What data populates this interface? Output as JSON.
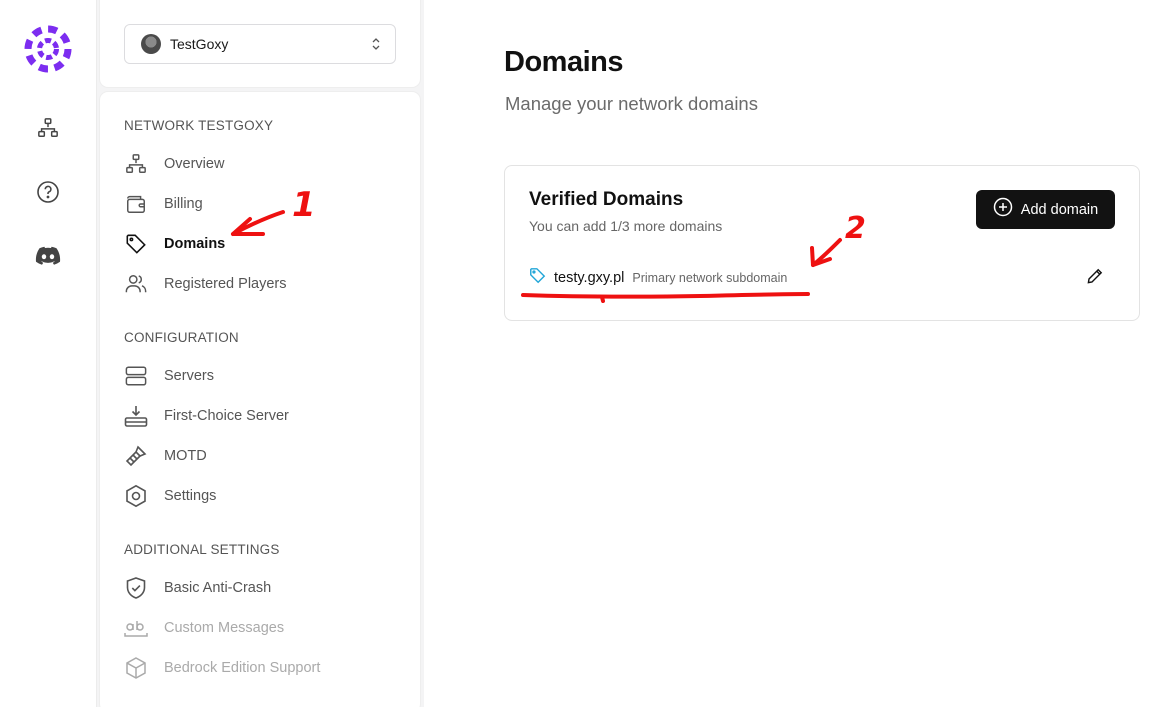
{
  "network_select": {
    "name": "TestGoxy"
  },
  "sidebar": {
    "sections": [
      {
        "title": "NETWORK TESTGOXY"
      },
      {
        "title": "CONFIGURATION"
      },
      {
        "title": "ADDITIONAL SETTINGS"
      }
    ],
    "items": [
      {
        "label": "Overview",
        "icon": "network-icon"
      },
      {
        "label": "Billing",
        "icon": "wallet-icon"
      },
      {
        "label": "Domains",
        "icon": "tag-icon"
      },
      {
        "label": "Registered Players",
        "icon": "users-icon"
      },
      {
        "label": "Servers",
        "icon": "server-icon"
      },
      {
        "label": "First-Choice Server",
        "icon": "download-tray-icon"
      },
      {
        "label": "MOTD",
        "icon": "brush-icon"
      },
      {
        "label": "Settings",
        "icon": "hexagon-gear-icon"
      },
      {
        "label": "Basic Anti-Crash",
        "icon": "shield-check-icon"
      },
      {
        "label": "Custom Messages",
        "icon": "text-ab-icon"
      },
      {
        "label": "Bedrock Edition Support",
        "icon": "cube-icon"
      }
    ]
  },
  "rail": {
    "icons": [
      "network-icon",
      "help-icon",
      "discord-icon"
    ]
  },
  "main": {
    "title": "Domains",
    "subtitle": "Manage your network domains",
    "card": {
      "title": "Verified Domains",
      "subtitle": "You can add 1/3 more domains",
      "add_button": "Add domain",
      "domains": [
        {
          "name": "testy.gxy.pl",
          "tag": "Primary network subdomain"
        }
      ]
    }
  },
  "annotations": {
    "label_1": "1",
    "label_2": "2",
    "color": "#ee1111"
  },
  "colors": {
    "brand": "#7c2df0",
    "accent_tag": "#22a6d8",
    "button_bg": "#121212"
  }
}
